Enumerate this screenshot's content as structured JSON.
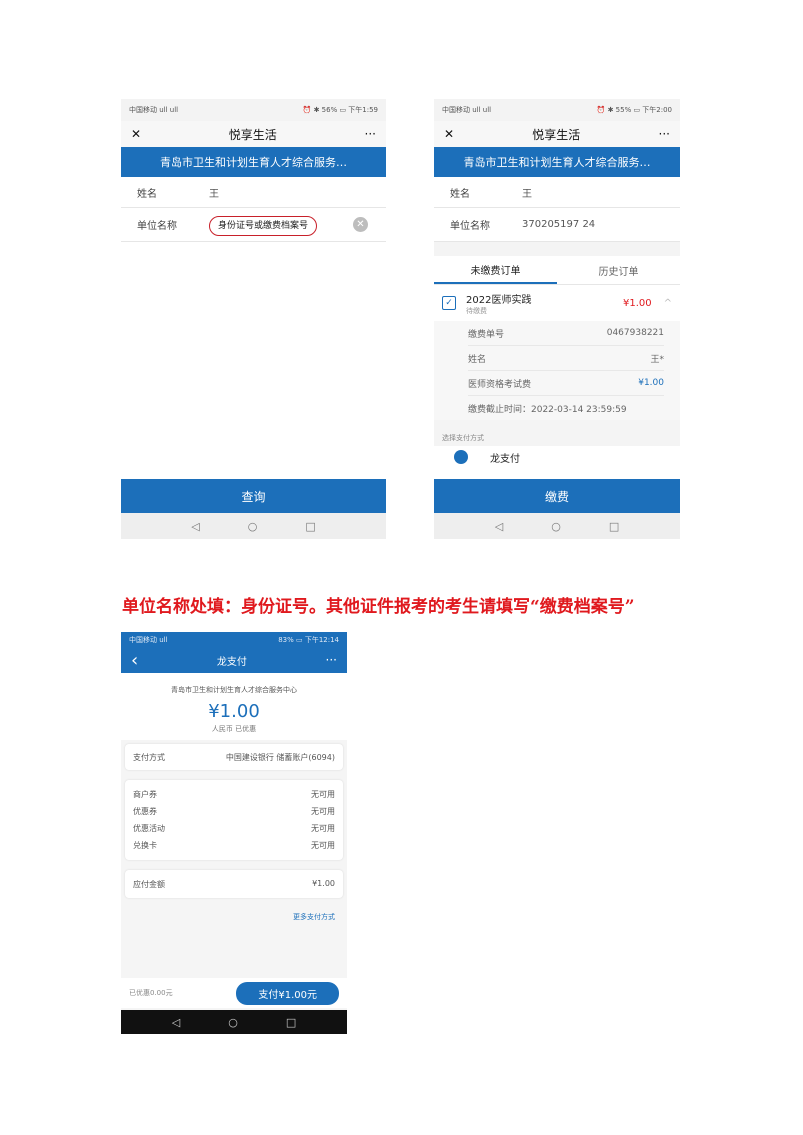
{
  "phone1": {
    "status_left": "中国移动 ull ull",
    "status_right": "⏰ ✱ 56% ▭ 下午1:59",
    "close_glyph": "✕",
    "title": "悦享生活",
    "more_glyph": "···",
    "banner": "青岛市卫生和计划生育人才综合服务…",
    "name_label": "姓名",
    "name_value": "王",
    "unit_label": "单位名称",
    "unit_value": "身份证号或缴费档案号",
    "clear_glyph": "✕",
    "button": "查询",
    "nav": [
      "◁",
      "○",
      "□"
    ]
  },
  "phone2": {
    "status_left": "中国移动 ull ull",
    "status_right": "⏰ ✱ 55% ▭ 下午2:00",
    "close_glyph": "✕",
    "title": "悦享生活",
    "more_glyph": "···",
    "banner": "青岛市卫生和计划生育人才综合服务…",
    "name_label": "姓名",
    "name_value": "王",
    "unit_label": "单位名称",
    "unit_value": "370205197    24",
    "tab_unpaid": "未缴费订单",
    "tab_history": "历史订单",
    "order_title": "2022医师实践",
    "order_sub": "待缴费",
    "order_amount": "¥1.00",
    "order_chevron": "^",
    "check_glyph": "✓",
    "details": [
      {
        "label": "缴费单号",
        "value": "0467938221"
      },
      {
        "label": "姓名",
        "value": "王*"
      },
      {
        "label": "医师资格考试费",
        "value": "¥1.00"
      }
    ],
    "deadline": "缴费截止时间：2022-03-14 23:59:59",
    "pay_method_label": "选择支付方式",
    "pay_option": "龙支付",
    "button": "缴费",
    "nav": [
      "◁",
      "○",
      "□"
    ]
  },
  "caption": "单位名称处填：身份证号。其他证件报考的考生请填写“缴费档案号”",
  "phone3": {
    "status_left": "中国移动 ull",
    "status_right": "83% ▭ 下午12:14",
    "back_glyph": "‹",
    "title": "龙支付",
    "more_glyph": "···",
    "merchant": "青岛市卫生和计划生育人才综合服务中心",
    "amount": "¥1.00",
    "amount_sub": "人民币 已优惠",
    "pay_method_label": "支付方式",
    "pay_method_value": "中国建设银行 储蓄账户(6094)",
    "coupons": [
      {
        "label": "商户券",
        "value": "无可用"
      },
      {
        "label": "优惠券",
        "value": "无可用"
      },
      {
        "label": "优惠活动",
        "value": "无可用"
      },
      {
        "label": "兑换卡",
        "value": "无可用"
      }
    ],
    "pay_amount_label": "应付金额",
    "pay_amount_value": "¥1.00",
    "more_methods": "更多支付方式",
    "discount": "已优惠0.00元",
    "pay_button": "支付¥1.00元",
    "nav": [
      "◁",
      "○",
      "□"
    ]
  }
}
